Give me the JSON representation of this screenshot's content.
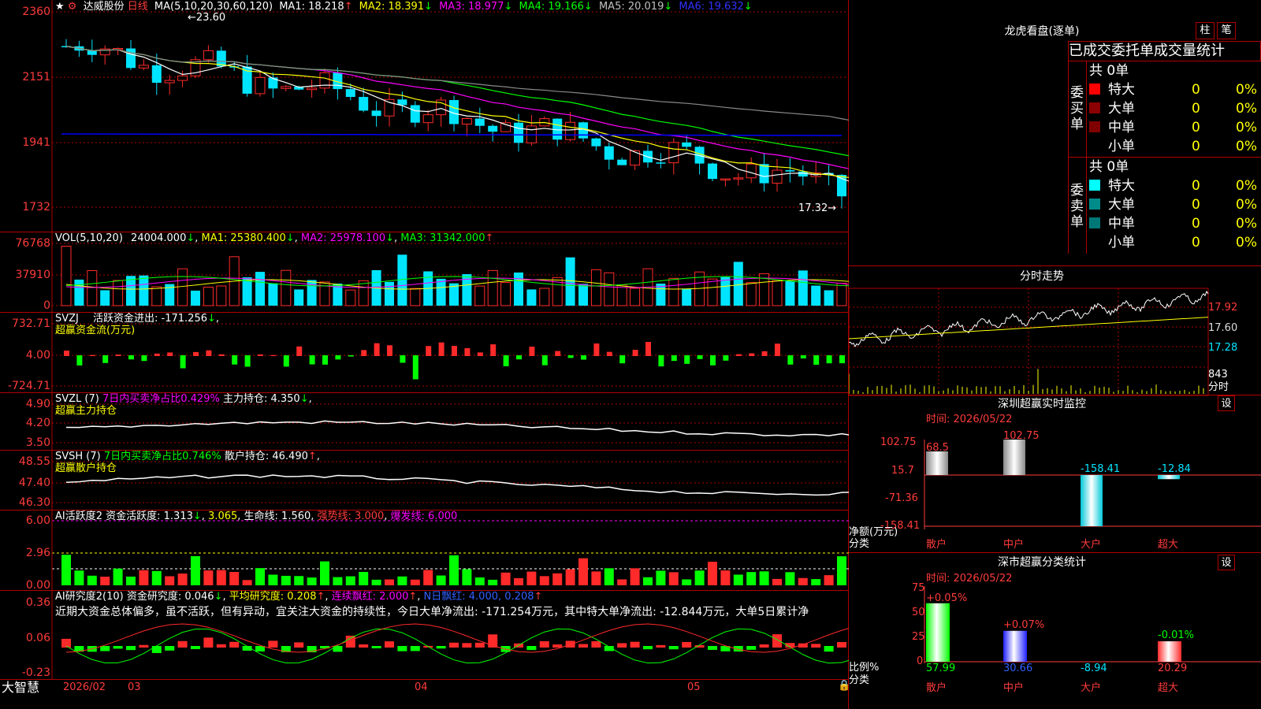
{
  "colors": {
    "up": "#ff2a2a",
    "down": "#00e5ff",
    "bg": "#000000",
    "grid": "#b00000",
    "ma5": "#ffffff",
    "ma10": "#ffff00",
    "ma20": "#ff00ff",
    "ma30": "#00ff00",
    "ma60": "#8a8a8a",
    "ma120": "#0000ff"
  },
  "header": {
    "star": "★",
    "icon": "⚙",
    "stock": "达威股份",
    "period": "日线",
    "params": "MA(5,10,20,30,60,120)",
    "ma": [
      {
        "label": "MA1: 18.218",
        "arrow": "↑"
      },
      {
        "label": "MA2: 18.391",
        "arrow": "↓"
      },
      {
        "label": "MA3: 18.977",
        "arrow": "↓"
      },
      {
        "label": "MA4: 19.166",
        "arrow": "↓"
      },
      {
        "label": "MA5: 20.019",
        "arrow": "↓"
      },
      {
        "label": "MA6: 19.632",
        "arrow": "↓"
      }
    ],
    "high_note": "23.60",
    "low_note": "17.32→"
  },
  "price_axis": [
    "2360",
    "2151",
    "1941",
    "1732"
  ],
  "volume": {
    "title": "VOL(5,10,20)",
    "value": "24004.000",
    "arrow": "↓",
    "ma1": "MA1: 25380.400",
    "ma1_arrow": "↓",
    "ma2": "MA2: 25978.100",
    "ma2_arrow": "↓",
    "ma3": "MA3: 31342.000",
    "ma3_arrow": "↑",
    "axis": [
      "76768",
      "37910",
      "0"
    ]
  },
  "svzj": {
    "title": "SVZJ",
    "label": "活跃资金进出: -171.256",
    "arrow": "↓",
    "sub": "超赢资金流(万元)",
    "axis": [
      "732.71",
      "4.00",
      "-724.71"
    ]
  },
  "svzl": {
    "title": "SVZL (7)",
    "label1": "7日内买卖净占比0.429%",
    "label2": "主力持仓: 4.350",
    "arrow": "↓",
    "sub": "超赢主力持仓",
    "axis": [
      "4.90",
      "4.20",
      "3.50"
    ]
  },
  "svsh": {
    "title": "SVSH (7)",
    "label1": "7日内买卖净占比0.746%",
    "label2": "散户持仓: 46.490",
    "arrow": "↑",
    "sub": "超赢散户持仓",
    "axis": [
      "48.55",
      "47.40",
      "46.30"
    ]
  },
  "ai1": {
    "title": "AI活跃度2",
    "label": "资金活跃度: 1.313",
    "arrow": "↓",
    "v2": "3.065",
    "lifeline": "生命线: 1.560",
    "strong": "强势线: 3.000",
    "burst": "爆发线: 6.000",
    "axis": [
      "6.00",
      "2.96",
      "0.00"
    ]
  },
  "ai2": {
    "title": "AI研究度2(10)",
    "label": "资金研究度: 0.046",
    "arrow": "↓",
    "avg": "平均研究度: 0.208",
    "arrow2": "↑",
    "red": "连续飘红: 2.000",
    "arrow3": "↑",
    "nred": "N日飘红: 4.000, 0.208",
    "arrow4": "↑",
    "comment": "近期大资金总体偏多，虽不活跃，但有异动，宜关注大资金的持续性，今日大单净流出: -171.254万元，其中特大单净流出: -12.844万元，大单5日累计净",
    "axis": [
      "0.36",
      "0.06",
      "-0.23"
    ]
  },
  "bottom": {
    "brand": "大智慧",
    "dates": [
      "2026/02",
      "03",
      "04",
      "05"
    ]
  },
  "dragon": {
    "title": "龙虎看盘(逐单)",
    "btn1": "柱",
    "btn2": "笔",
    "tabs": [
      "已成交",
      "委托单",
      "成交量统计"
    ],
    "buy": {
      "side": "委买单",
      "total": "共 0单",
      "rows": [
        {
          "name": "特大",
          "val": "0",
          "pct": "0%",
          "c": "#ff0000"
        },
        {
          "name": "大单",
          "val": "0",
          "pct": "0%",
          "c": "#8b0000"
        },
        {
          "name": "中单",
          "val": "0",
          "pct": "0%",
          "c": "#800000"
        },
        {
          "name": "小单",
          "val": "0",
          "pct": "0%",
          "c": "#000000"
        }
      ]
    },
    "sell": {
      "side": "委卖单",
      "total": "共 0单",
      "rows": [
        {
          "name": "特大",
          "val": "0",
          "pct": "0%",
          "c": "#00ffff"
        },
        {
          "name": "大单",
          "val": "0",
          "pct": "0%",
          "c": "#008b8b"
        },
        {
          "name": "中单",
          "val": "0",
          "pct": "0%",
          "c": "#007777"
        },
        {
          "name": "小单",
          "val": "0",
          "pct": "0%",
          "c": "#000000"
        }
      ]
    }
  },
  "intraday": {
    "title": "分时走势",
    "axis": [
      "17.92",
      "17.60",
      "17.28"
    ],
    "vol": "843",
    "unit": "分时"
  },
  "monitor": {
    "title": "深圳超赢实时监控",
    "btn": "设",
    "time": "时间: 2026/05/22",
    "axis": [
      "102.75",
      "15.7",
      "-71.36",
      "-158.41"
    ],
    "yl": "净额(万元)",
    "xl": "分类",
    "cats": [
      "散户",
      "中户",
      "大户",
      "超大"
    ],
    "values": [
      68.5,
      102.75,
      -158.41,
      -12.84
    ],
    "labels": [
      "68.5",
      "102.75",
      "-158.41",
      "-12.84"
    ]
  },
  "stat": {
    "title": "深市超赢分类统计",
    "btn": "设",
    "time": "时间: 2026/05/22",
    "axis": [
      "75",
      "50",
      "25",
      "0"
    ],
    "yl": "比例%",
    "xl": "分类",
    "cats": [
      "散户",
      "中户",
      "大户",
      "超大"
    ],
    "pct_change": [
      "+0.05%",
      "+0.07%",
      "",
      "-0.01%"
    ],
    "values": [
      "57.99",
      "30.66",
      "-8.94",
      "20.29"
    ],
    "heights": [
      57.99,
      30.66,
      0,
      20.29
    ]
  }
}
